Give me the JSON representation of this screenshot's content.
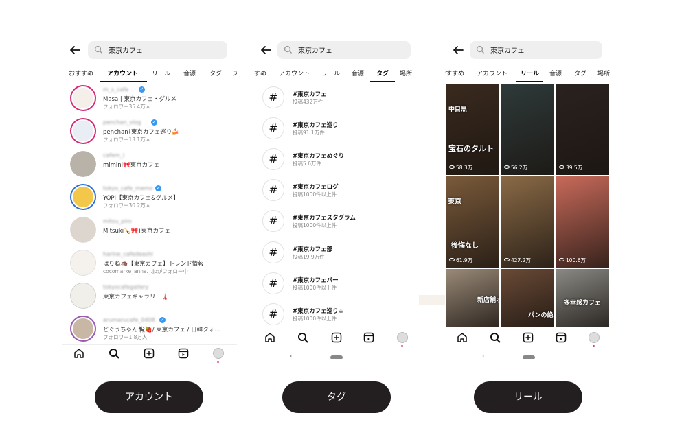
{
  "query": "東京カフェ",
  "accounts_panel": {
    "tabs": [
      {
        "label": "おすすめ"
      },
      {
        "label": "アカウント",
        "active": true
      },
      {
        "label": "リール"
      },
      {
        "label": "音源"
      },
      {
        "label": "タグ"
      },
      {
        "label": "ス"
      }
    ],
    "accounts": [
      {
        "username": "m_s_cafe",
        "verified": true,
        "line2": "Masa | 東京カフェ・グルメ",
        "line3": "フォロワー35.4万人",
        "ring": true
      },
      {
        "username": "penchan_vlog",
        "verified": true,
        "line2": "penchan⌇東京カフェ巡り🍰",
        "line3": "フォロワー13.1万人",
        "ring": true
      },
      {
        "username": "cafem_i",
        "verified": false,
        "line2": "mimini🎀東京カフェ",
        "line3": "",
        "ring": false
      },
      {
        "username": "tokyo_cafe_memo",
        "verified": true,
        "line2": "YOPI【東京カフェ&グルメ】",
        "line3": "フォロワー30.2万人",
        "ring": true
      },
      {
        "username": "mitsu_piro",
        "verified": false,
        "line2": "Mitsuki🍾🎀⌇東京カフェ",
        "line3": "",
        "ring": false
      },
      {
        "username": "harine_cafedeashi",
        "verified": false,
        "line2": "はりね🦔【東京カフェ】トレンド情報",
        "line3": "cocomarke_anna._.jpがフォロー中",
        "ring": false
      },
      {
        "username": "tokyocafegallery",
        "verified": false,
        "line2": "東京カフェギャラリー🗼",
        "line3": "",
        "ring": false
      },
      {
        "username": "arumarucafe_0408",
        "verified": true,
        "line2": "どぐうちゃん🐈‍⬛🍓/ 東京カフェ / 日韓クォ…",
        "line3": "フォロワー1.8万人",
        "ring": true
      }
    ]
  },
  "tags_panel": {
    "tabs": [
      {
        "label": "すめ"
      },
      {
        "label": "アカウント"
      },
      {
        "label": "リール"
      },
      {
        "label": "音源"
      },
      {
        "label": "タグ",
        "active": true
      },
      {
        "label": "場所"
      }
    ],
    "tags": [
      {
        "name": "#東京カフェ",
        "count": "投稿432万件"
      },
      {
        "name": "#東京カフェ巡り",
        "count": "投稿91.1万件"
      },
      {
        "name": "#東京カフェめぐり",
        "count": "投稿5.6万件"
      },
      {
        "name": "#東京カフェログ",
        "count": "投稿1000件以上件"
      },
      {
        "name": "#東京カフェスタグラム",
        "count": "投稿1000件以上件"
      },
      {
        "name": "#東京カフェ部",
        "count": "投稿19.9万件"
      },
      {
        "name": "#東京カフェバー",
        "count": "投稿1000件以上件"
      },
      {
        "name": "#東京カフェ巡り☕",
        "count": "投稿1000件以上件"
      }
    ]
  },
  "reels_panel": {
    "tabs": [
      {
        "label": "おすすめ"
      },
      {
        "label": "アカウント"
      },
      {
        "label": "リール",
        "active": true
      },
      {
        "label": "音源"
      },
      {
        "label": "タグ"
      },
      {
        "label": "場所"
      }
    ],
    "reels": [
      {
        "views": "58.3万",
        "overlay": "宝石のタルト",
        "overlay2": "中目黒",
        "bg": "#3a2a1e"
      },
      {
        "views": "56.2万",
        "overlay": "",
        "overlay2": "",
        "bg": "#2e3a3a"
      },
      {
        "views": "39.5万",
        "overlay": "",
        "overlay2": "",
        "bg": "#2a221e"
      },
      {
        "views": "61.9万",
        "overlay": "後悔なし",
        "overlay2": "東京",
        "bg": "#7a5a3a"
      },
      {
        "views": "427.2万",
        "overlay": "",
        "overlay2": "",
        "bg": "#8a6a46"
      },
      {
        "views": "100.6万",
        "overlay": "",
        "overlay2": "",
        "bg": "#c86a5a"
      },
      {
        "views": "",
        "overlay": "新店舗オー",
        "overlay2": "",
        "bg": "#9a8a78"
      },
      {
        "views": "",
        "overlay": "パンの絶",
        "overlay2": "",
        "bg": "#6a4a36"
      },
      {
        "views": "",
        "overlay": "多幸感カフェ",
        "overlay2": "",
        "bg": "#8a8a84"
      }
    ]
  },
  "nav_icons": [
    "home-icon",
    "search-icon",
    "create-icon",
    "reels-icon",
    "profile-icon"
  ],
  "captions": {
    "accounts": "アカウント",
    "tags": "タグ",
    "reels": "リール"
  }
}
